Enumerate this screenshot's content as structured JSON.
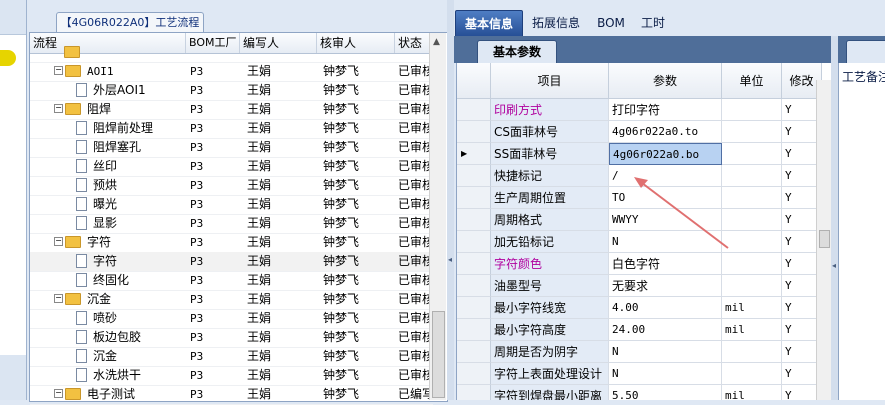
{
  "left_panel": {
    "title": "【4G06R022A0】工艺流程",
    "columns": [
      "流程",
      "BOM工厂",
      "编写人",
      "核审人",
      "状态"
    ],
    "rows": [
      {
        "name": "",
        "bom": "",
        "writer": "",
        "reviewer": "",
        "status": "",
        "level": 1,
        "kind": "cut"
      },
      {
        "name": "AOI1",
        "bom": "P3",
        "writer": "王娟",
        "reviewer": "钟梦飞",
        "status": "已审核",
        "level": 1,
        "kind": "folder"
      },
      {
        "name": "外层AOI1",
        "bom": "P3",
        "writer": "王娟",
        "reviewer": "钟梦飞",
        "status": "已审核",
        "level": 2,
        "kind": "doc"
      },
      {
        "name": "阻焊",
        "bom": "P3",
        "writer": "王娟",
        "reviewer": "钟梦飞",
        "status": "已审核",
        "level": 1,
        "kind": "folder"
      },
      {
        "name": "阻焊前处理",
        "bom": "P3",
        "writer": "王娟",
        "reviewer": "钟梦飞",
        "status": "已审核",
        "level": 2,
        "kind": "doc"
      },
      {
        "name": "阻焊塞孔",
        "bom": "P3",
        "writer": "王娟",
        "reviewer": "钟梦飞",
        "status": "已审核",
        "level": 2,
        "kind": "doc"
      },
      {
        "name": "丝印",
        "bom": "P3",
        "writer": "王娟",
        "reviewer": "钟梦飞",
        "status": "已审核",
        "level": 2,
        "kind": "doc"
      },
      {
        "name": "预烘",
        "bom": "P3",
        "writer": "王娟",
        "reviewer": "钟梦飞",
        "status": "已审核",
        "level": 2,
        "kind": "doc"
      },
      {
        "name": "曝光",
        "bom": "P3",
        "writer": "王娟",
        "reviewer": "钟梦飞",
        "status": "已审核",
        "level": 2,
        "kind": "doc"
      },
      {
        "name": "显影",
        "bom": "P3",
        "writer": "王娟",
        "reviewer": "钟梦飞",
        "status": "已审核",
        "level": 2,
        "kind": "doc"
      },
      {
        "name": "字符",
        "bom": "P3",
        "writer": "王娟",
        "reviewer": "钟梦飞",
        "status": "已审核",
        "level": 1,
        "kind": "folder"
      },
      {
        "name": "字符",
        "bom": "P3",
        "writer": "王娟",
        "reviewer": "钟梦飞",
        "status": "已审核",
        "level": 2,
        "kind": "doc",
        "selected": true
      },
      {
        "name": "终固化",
        "bom": "P3",
        "writer": "王娟",
        "reviewer": "钟梦飞",
        "status": "已审核",
        "level": 2,
        "kind": "doc"
      },
      {
        "name": "沉金",
        "bom": "P3",
        "writer": "王娟",
        "reviewer": "钟梦飞",
        "status": "已审核",
        "level": 1,
        "kind": "folder"
      },
      {
        "name": "喷砂",
        "bom": "P3",
        "writer": "王娟",
        "reviewer": "钟梦飞",
        "status": "已审核",
        "level": 2,
        "kind": "doc"
      },
      {
        "name": "板边包胶",
        "bom": "P3",
        "writer": "王娟",
        "reviewer": "钟梦飞",
        "status": "已审核",
        "level": 2,
        "kind": "doc"
      },
      {
        "name": "沉金",
        "bom": "P3",
        "writer": "王娟",
        "reviewer": "钟梦飞",
        "status": "已审核",
        "level": 2,
        "kind": "doc"
      },
      {
        "name": "水洗烘干",
        "bom": "P3",
        "writer": "王娟",
        "reviewer": "钟梦飞",
        "status": "已审核",
        "level": 2,
        "kind": "doc"
      },
      {
        "name": "电子测试",
        "bom": "P3",
        "writer": "王娟",
        "reviewer": "钟梦飞",
        "status": "已编写",
        "level": 1,
        "kind": "folder"
      }
    ]
  },
  "right_tabs": [
    "基本信息",
    "拓展信息",
    "BOM",
    "工时"
  ],
  "sub_tab": "基本参数",
  "grid": {
    "columns": [
      "项目",
      "参数",
      "单位",
      "修改"
    ],
    "rows": [
      {
        "item": "印刷方式",
        "param": "打印字符",
        "unit": "",
        "mod": "Y",
        "pink": true
      },
      {
        "item": "CS面菲林号",
        "param": "4g06r022a0.to",
        "unit": "",
        "mod": "Y"
      },
      {
        "item": "SS面菲林号",
        "param": "4g06r022a0.bo",
        "unit": "",
        "mod": "Y",
        "selected": true
      },
      {
        "item": "快捷标记",
        "param": "/",
        "unit": "",
        "mod": "Y"
      },
      {
        "item": "生产周期位置",
        "param": "TO",
        "unit": "",
        "mod": "Y"
      },
      {
        "item": "周期格式",
        "param": "WWYY",
        "unit": "",
        "mod": "Y"
      },
      {
        "item": "加无铅标记",
        "param": "N",
        "unit": "",
        "mod": "Y"
      },
      {
        "item": "字符颜色",
        "param": "白色字符",
        "unit": "",
        "mod": "Y",
        "pink": true
      },
      {
        "item": "油墨型号",
        "param": "无要求",
        "unit": "",
        "mod": "Y"
      },
      {
        "item": "最小字符线宽",
        "param": "4.00",
        "unit": "mil",
        "mod": "Y"
      },
      {
        "item": "最小字符高度",
        "param": "24.00",
        "unit": "mil",
        "mod": "Y"
      },
      {
        "item": "周期是否为阴字",
        "param": "N",
        "unit": "",
        "mod": "Y"
      },
      {
        "item": "字符上表面处理设计",
        "param": "N",
        "unit": "",
        "mod": "Y"
      },
      {
        "item": "字符到焊盘最小距离",
        "param": "5.50",
        "unit": "mil",
        "mod": "Y"
      }
    ]
  },
  "far_right_label": "工艺备注",
  "colors": {
    "accent": "#254d94",
    "pink_text": "#b0009e",
    "annotation": "#e07070"
  }
}
